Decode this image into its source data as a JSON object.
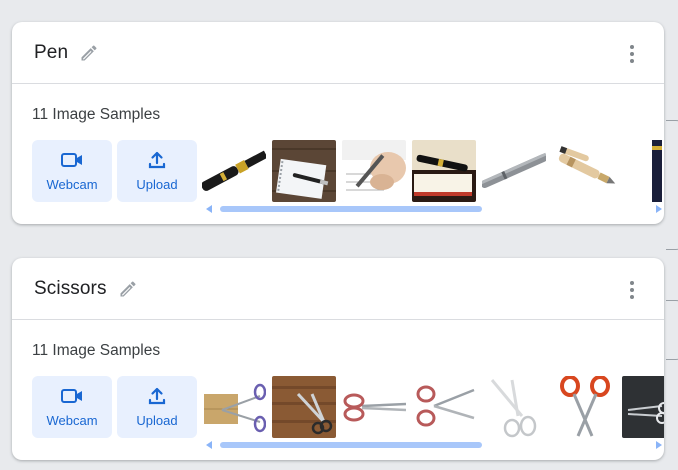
{
  "classes": [
    {
      "name": "Pen",
      "samples_label": "11 Image Samples",
      "webcam_label": "Webcam",
      "upload_label": "Upload",
      "edit_icon": "pencil-icon",
      "menu_icon": "more-vert-icon"
    },
    {
      "name": "Scissors",
      "samples_label": "11 Image Samples",
      "webcam_label": "Webcam",
      "upload_label": "Upload",
      "edit_icon": "pencil-icon",
      "menu_icon": "more-vert-icon"
    }
  ],
  "colors": {
    "accent": "#1967d2",
    "button_bg": "#e8f0fe",
    "scrollbar": "#a8c7fa"
  }
}
